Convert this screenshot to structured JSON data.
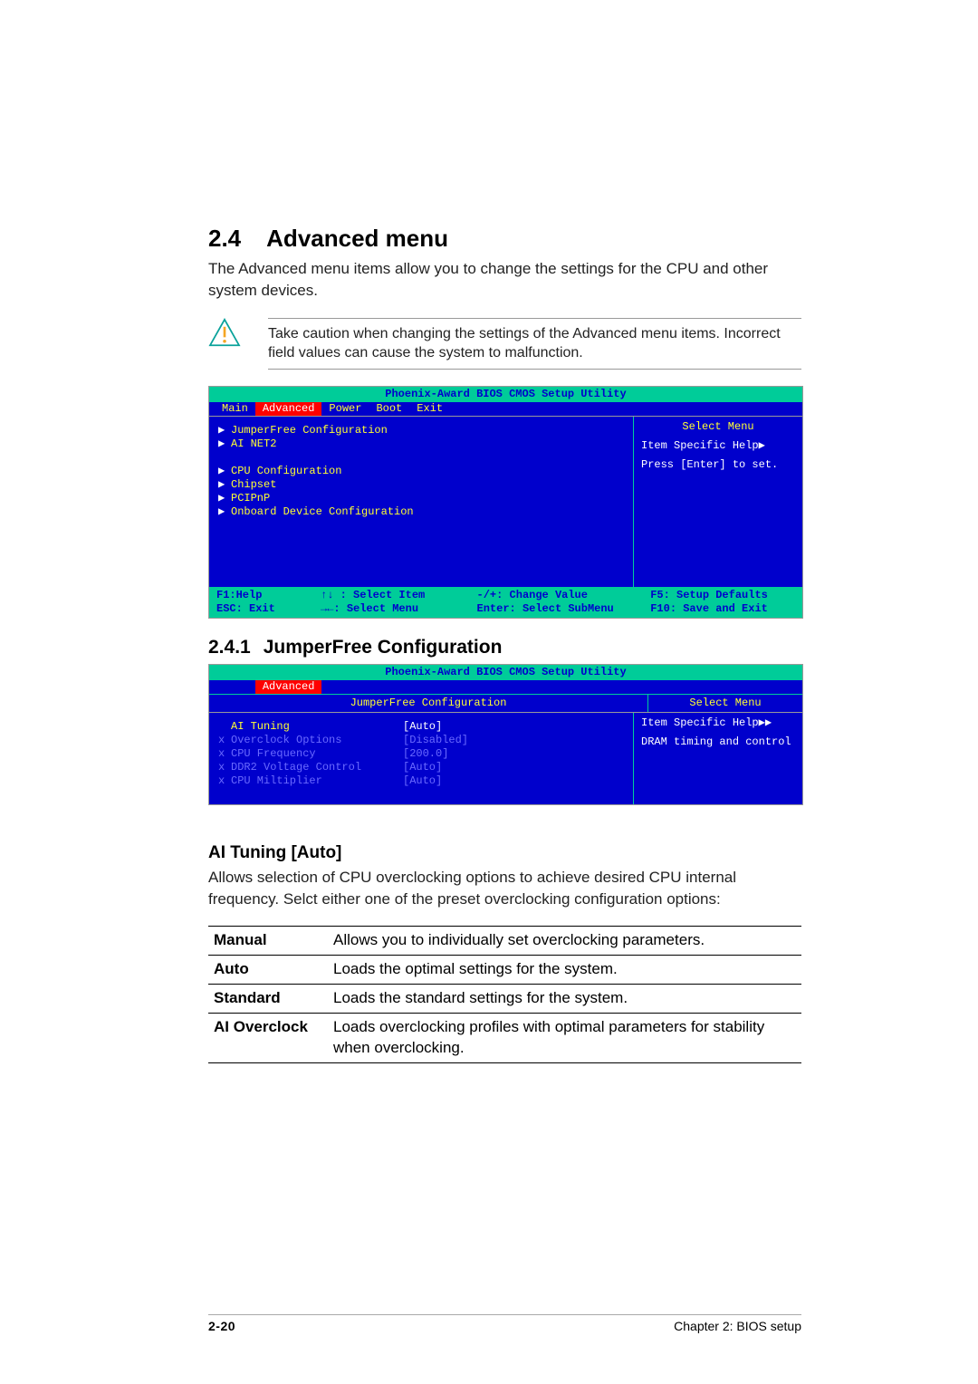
{
  "section": {
    "number": "2.4",
    "title": "Advanced menu",
    "intro": "The Advanced menu items allow you to change the settings for the CPU and other system devices.",
    "caution": "Take caution when changing the settings of the Advanced menu items. Incorrect field values can cause the system to malfunction."
  },
  "bios1": {
    "title": "Phoenix-Award BIOS CMOS Setup Utility",
    "menu": [
      "Main",
      "Advanced",
      "Power",
      "Boot",
      "Exit"
    ],
    "selected_menu_index": 1,
    "left_items": [
      "JumperFree Configuration",
      "AI NET2",
      "",
      "CPU Configuration",
      "Chipset",
      "PCIPnP",
      "Onboard Device Configuration"
    ],
    "right": {
      "select_menu": "Select Menu",
      "help_label": "Item Specific Help",
      "help_body": "Press [Enter] to set."
    },
    "footer": [
      "F1:Help",
      "↑↓ : Select Item",
      "-/+: Change Value",
      "F5: Setup Defaults",
      "ESC: Exit",
      "→←: Select Menu",
      "Enter: Select SubMenu",
      "F10: Save and Exit"
    ]
  },
  "subsection": {
    "number": "2.4.1",
    "title": "JumperFree Configuration"
  },
  "bios2": {
    "title": "Phoenix-Award BIOS CMOS Setup Utility",
    "menu_single": "Advanced",
    "panel_title": "JumperFree Configuration",
    "rows": [
      {
        "lead": "",
        "label": "AI Tuning",
        "value": "[Auto]",
        "dim": false
      },
      {
        "lead": "x",
        "label": "Overclock Options",
        "value": "[Disabled]",
        "dim": true
      },
      {
        "lead": "x",
        "label": "CPU Frequency",
        "value": "[200.0]",
        "dim": true
      },
      {
        "lead": "x",
        "label": "DDR2 Voltage Control",
        "value": "[Auto]",
        "dim": true
      },
      {
        "lead": "x",
        "label": "CPU Miltiplier",
        "value": "[Auto]",
        "dim": true
      }
    ],
    "right": {
      "select_menu": "Select Menu",
      "help_label": "Item Specific Help",
      "help_body": "DRAM timing and control"
    }
  },
  "option": {
    "heading": "AI Tuning [Auto]",
    "body": "Allows selection of CPU overclocking options to achieve desired CPU internal frequency. Selct either one of the preset overclocking configuration options:",
    "rows": [
      {
        "name": "Manual",
        "desc": "Allows you to individually set overclocking parameters."
      },
      {
        "name": "Auto",
        "desc": "Loads the optimal settings for the system."
      },
      {
        "name": "Standard",
        "desc": "Loads the standard settings for the system."
      },
      {
        "name": "AI Overclock",
        "desc": "Loads overclocking profiles with optimal parameters for stability when overclocking."
      }
    ]
  },
  "footer": {
    "page": "2-20",
    "chapter": "Chapter 2: BIOS setup"
  }
}
